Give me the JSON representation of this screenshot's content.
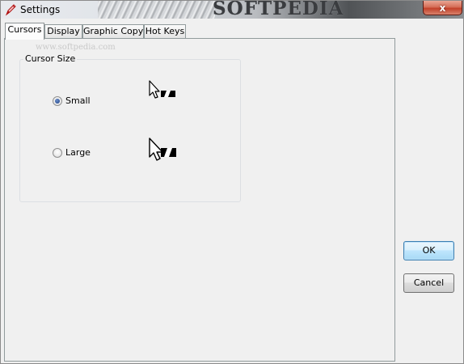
{
  "window": {
    "title": "Settings",
    "background_watermark": "SOFTPEDIA",
    "close_glyph": "x",
    "icon": "pencil-icon"
  },
  "tabs": [
    {
      "label": "Cursors",
      "active": true
    },
    {
      "label": "Display",
      "active": false
    },
    {
      "label": "Graphic Copy",
      "active": false
    },
    {
      "label": "Hot Keys",
      "active": false
    }
  ],
  "cursors_tab": {
    "watermark": "www.softpedia.com",
    "group_title": "Cursor Size",
    "options": [
      {
        "label": "Small",
        "selected": true,
        "preview_icon": "small-cursor-icon"
      },
      {
        "label": "Large",
        "selected": false,
        "preview_icon": "large-cursor-icon"
      }
    ]
  },
  "buttons": {
    "ok_label": "OK",
    "cancel_label": "Cancel"
  },
  "colors": {
    "window_bg": "#f0f0f0",
    "close_button": "#c2412a",
    "radio_selected": "#1d3f84",
    "default_button_border": "#3c7fb1"
  }
}
